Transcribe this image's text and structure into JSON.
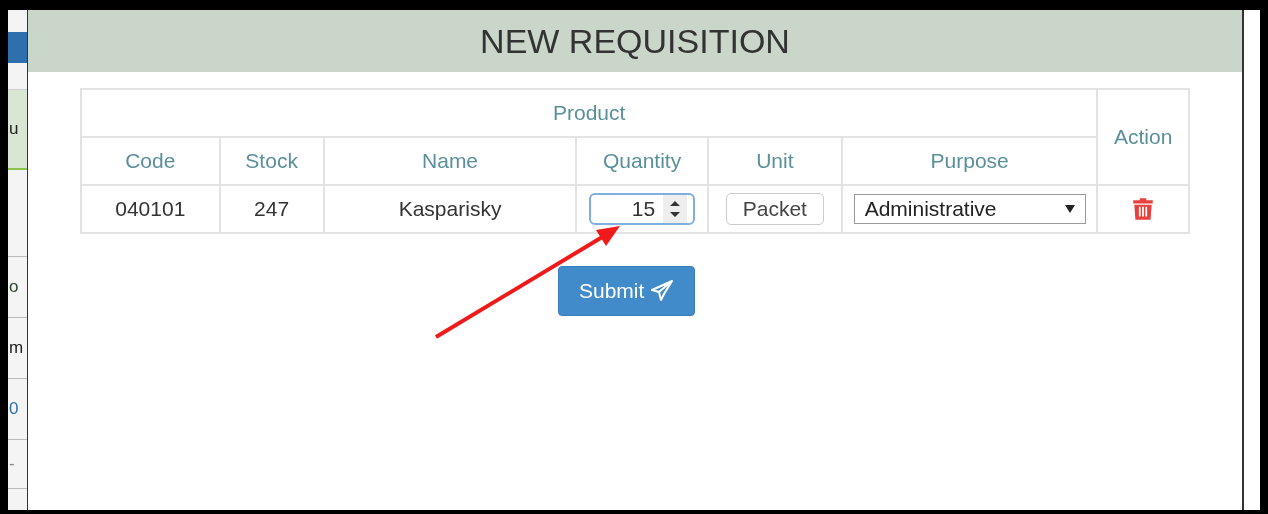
{
  "background_page": {
    "fragments": [
      "u",
      "o",
      "m",
      "0",
      "-"
    ]
  },
  "modal": {
    "title": "NEW REQUISITION",
    "table": {
      "group_header": "Product",
      "action_header": "Action",
      "columns": [
        "Code",
        "Stock",
        "Name",
        "Quantity",
        "Unit",
        "Purpose"
      ],
      "rows": [
        {
          "code": "040101",
          "stock": "247",
          "name": "Kasparisky",
          "quantity": "15",
          "unit": "Packet",
          "purpose": "Administrative"
        }
      ]
    },
    "submit_button": "Submit"
  },
  "annotation": {
    "kind": "arrow"
  }
}
